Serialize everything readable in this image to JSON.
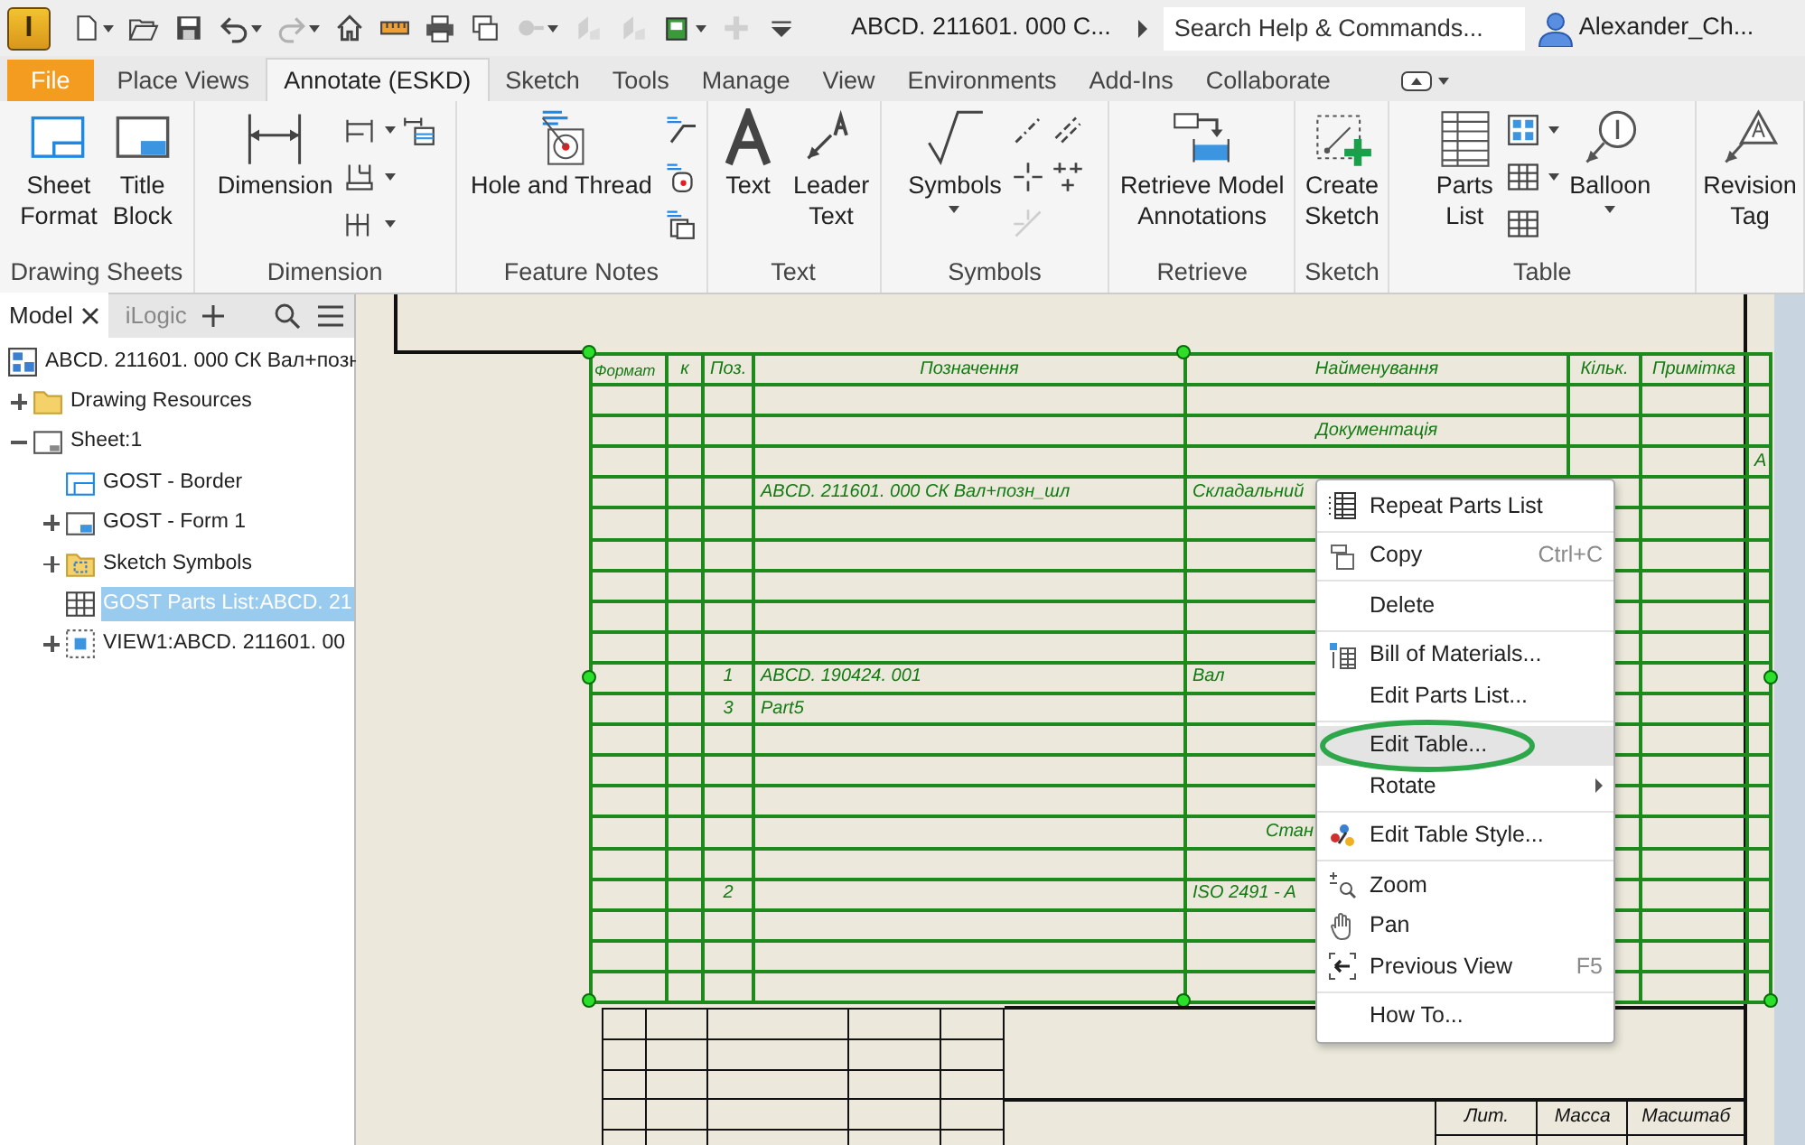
{
  "app_logo": "I",
  "quick_access": [
    {
      "dropdown": true,
      "disabled": false
    },
    {
      "dropdown": false,
      "disabled": false
    },
    {
      "dropdown": false,
      "disabled": false
    },
    {
      "dropdown": true,
      "disabled": false
    },
    {
      "dropdown": true,
      "disabled": true
    },
    {
      "dropdown": false,
      "disabled": false
    },
    {
      "dropdown": false,
      "disabled": false
    },
    {
      "dropdown": false,
      "disabled": false
    },
    {
      "dropdown": false,
      "disabled": false
    },
    {
      "dropdown": true,
      "disabled": true
    },
    {
      "dropdown": false,
      "disabled": true
    },
    {
      "dropdown": false,
      "disabled": true
    },
    {
      "dropdown": true,
      "disabled": false
    },
    {
      "dropdown": false,
      "disabled": true
    },
    {
      "dropdown": false,
      "disabled": false
    }
  ],
  "document_title": "ABCD. 211601. 000 C...",
  "search": {
    "placeholder": "Search Help & Commands..."
  },
  "user": {
    "name": "Alexander_Ch..."
  },
  "tabs": [
    {
      "label": "File",
      "kind": "file",
      "selected": false
    },
    {
      "label": "Place Views",
      "kind": "tab",
      "selected": false
    },
    {
      "label": "Annotate (ESKD)",
      "kind": "tab",
      "selected": true
    },
    {
      "label": "Sketch",
      "kind": "tab",
      "selected": false
    },
    {
      "label": "Tools",
      "kind": "tab",
      "selected": false
    },
    {
      "label": "Manage",
      "kind": "tab",
      "selected": false
    },
    {
      "label": "View",
      "kind": "tab",
      "selected": false
    },
    {
      "label": "Environments",
      "kind": "tab",
      "selected": false
    },
    {
      "label": "Add-Ins",
      "kind": "tab",
      "selected": false
    },
    {
      "label": "Collaborate",
      "kind": "tab",
      "selected": false
    }
  ],
  "ribbon": [
    {
      "label": "Drawing Sheets",
      "tools": [
        {
          "kind": "large",
          "label": "Sheet\nFormat",
          "dropdown": false
        },
        {
          "kind": "large",
          "label": "Title\nBlock",
          "dropdown": false
        }
      ]
    },
    {
      "label": "Dimension",
      "tools": [
        {
          "kind": "large",
          "label": "Dimension",
          "dropdown": false
        },
        {
          "kind": "stack",
          "items": [
            {
              "dropdown": true,
              "disabled": false
            },
            {
              "dropdown": true,
              "disabled": false
            },
            {
              "dropdown": true,
              "disabled": false
            }
          ]
        },
        {
          "kind": "stack",
          "items": [
            {
              "dropdown": false,
              "disabled": false
            }
          ]
        }
      ]
    },
    {
      "label": "Feature Notes",
      "tools": [
        {
          "kind": "large",
          "label": "Hole and Thread",
          "dropdown": false
        },
        {
          "kind": "stack",
          "items": [
            {
              "dropdown": false,
              "disabled": false
            },
            {
              "dropdown": false,
              "disabled": false
            },
            {
              "dropdown": false,
              "disabled": false
            }
          ]
        }
      ]
    },
    {
      "label": "Text",
      "tools": [
        {
          "kind": "large",
          "label": "Text",
          "dropdown": false
        },
        {
          "kind": "large",
          "label": "Leader\nText",
          "dropdown": false
        }
      ]
    },
    {
      "label": "Symbols",
      "tools": [
        {
          "kind": "large",
          "label": "Symbols",
          "dropdown": true
        },
        {
          "kind": "stack",
          "items": [
            {
              "dropdown": false,
              "disabled": false
            },
            {
              "dropdown": false,
              "disabled": false
            },
            {
              "dropdown": false,
              "disabled": true
            }
          ]
        },
        {
          "kind": "stack",
          "items": [
            {
              "dropdown": false,
              "disabled": false
            },
            {
              "dropdown": false,
              "disabled": false
            }
          ]
        }
      ]
    },
    {
      "label": "Retrieve",
      "tools": [
        {
          "kind": "large",
          "label": "Retrieve Model\nAnnotations",
          "dropdown": false
        }
      ]
    },
    {
      "label": "Sketch",
      "tools": [
        {
          "kind": "large",
          "label": "Create\nSketch",
          "dropdown": false
        }
      ]
    },
    {
      "label": "Table",
      "tools": [
        {
          "kind": "large",
          "label": "Parts\nList",
          "dropdown": false
        },
        {
          "kind": "stack",
          "items": [
            {
              "dropdown": true,
              "disabled": false
            },
            {
              "dropdown": true,
              "disabled": false
            },
            {
              "dropdown": false,
              "disabled": false
            }
          ]
        },
        {
          "kind": "large",
          "label": "Balloon",
          "dropdown": true
        }
      ]
    },
    {
      "tools": [
        {
          "kind": "large",
          "label": "Revision\nTag",
          "dropdown": false
        }
      ]
    }
  ],
  "browser": {
    "tabs": [
      {
        "label": "Model",
        "selected": true,
        "closable": true
      },
      {
        "label": "iLogic",
        "selected": false,
        "closable": false
      }
    ],
    "tree": [
      {
        "label": "ABCD. 211601. 000 СК Вал+позн",
        "selected": false,
        "children": [
          {
            "label": "Drawing Resources",
            "expanded": false,
            "selected": false
          },
          {
            "label": "Sheet:1",
            "expanded": true,
            "selected": false,
            "children": [
              {
                "label": "GOST - Border",
                "selected": false
              },
              {
                "label": "GOST - Form 1",
                "expanded": false,
                "selected": false
              },
              {
                "label": "Sketch Symbols",
                "expanded": false,
                "selected": false
              },
              {
                "label": "GOST Parts List:ABCD. 21",
                "selected": true
              },
              {
                "label": "VIEW1:ABCD. 211601. 00",
                "expanded": false,
                "selected": false
              }
            ]
          }
        ]
      }
    ]
  },
  "parts_list": {
    "columns": [
      "Формат",
      "к",
      "Поз.",
      "Позначення",
      "Найменування",
      "Кільк.",
      "Примітка"
    ],
    "rows": [
      {
        "kind": "blank"
      },
      {
        "kind": "heading",
        "name": "Документація"
      },
      {
        "kind": "item",
        "column_8": "А"
      },
      {
        "kind": "item",
        "designation": "ABCD. 211601. 000 СК Вал+позн_шл",
        "name": "Складальний"
      },
      {
        "kind": "blank"
      },
      {
        "kind": "blank"
      },
      {
        "kind": "blank"
      },
      {
        "kind": "blank"
      },
      {
        "kind": "blank"
      },
      {
        "kind": "item",
        "poz": "1",
        "designation": "ABCD. 190424. 001",
        "name": "Вал"
      },
      {
        "kind": "item",
        "poz": "3",
        "designation": "Part5"
      },
      {
        "kind": "blank"
      },
      {
        "kind": "blank"
      },
      {
        "kind": "blank"
      },
      {
        "kind": "covered_heading",
        "name": "Стан"
      },
      {
        "kind": "blank"
      },
      {
        "kind": "item",
        "poz": "2",
        "name": "ISO 2491 - A"
      },
      {
        "kind": "blank"
      },
      {
        "kind": "blank"
      },
      {
        "kind": "blank"
      }
    ]
  },
  "title_block": {
    "labels": [
      "Лит.",
      "Масса",
      "Масштаб"
    ]
  },
  "context_menu": [
    {
      "kind": "item",
      "label": "Repeat Parts List",
      "selected": false,
      "circled": false,
      "submenu": false
    },
    {
      "kind": "separator"
    },
    {
      "kind": "item",
      "label": "Copy",
      "shortcut": "Ctrl+C",
      "selected": false,
      "circled": false,
      "submenu": false
    },
    {
      "kind": "separator"
    },
    {
      "kind": "item",
      "label": "Delete",
      "selected": false,
      "circled": false,
      "submenu": false
    },
    {
      "kind": "separator"
    },
    {
      "kind": "item",
      "label": "Bill of Materials...",
      "selected": false,
      "circled": false,
      "submenu": false
    },
    {
      "kind": "item",
      "label": "Edit Parts List...",
      "selected": false,
      "circled": false,
      "submenu": false
    },
    {
      "kind": "separator"
    },
    {
      "kind": "item",
      "label": "Edit Table...",
      "selected": true,
      "circled": true,
      "submenu": false
    },
    {
      "kind": "item",
      "label": "Rotate",
      "selected": false,
      "circled": false,
      "submenu": true
    },
    {
      "kind": "separator"
    },
    {
      "kind": "item",
      "label": "Edit Table Style...",
      "selected": false,
      "circled": false,
      "submenu": false
    },
    {
      "kind": "separator"
    },
    {
      "kind": "item",
      "label": "Zoom",
      "selected": false,
      "circled": false,
      "submenu": false
    },
    {
      "kind": "item",
      "label": "Pan",
      "selected": false,
      "circled": false,
      "submenu": false
    },
    {
      "kind": "item",
      "label": "Previous View",
      "shortcut": "F5",
      "selected": false,
      "circled": false,
      "submenu": false
    },
    {
      "kind": "separator"
    },
    {
      "kind": "item",
      "label": "How To...",
      "selected": false,
      "circled": false,
      "submenu": false
    }
  ]
}
